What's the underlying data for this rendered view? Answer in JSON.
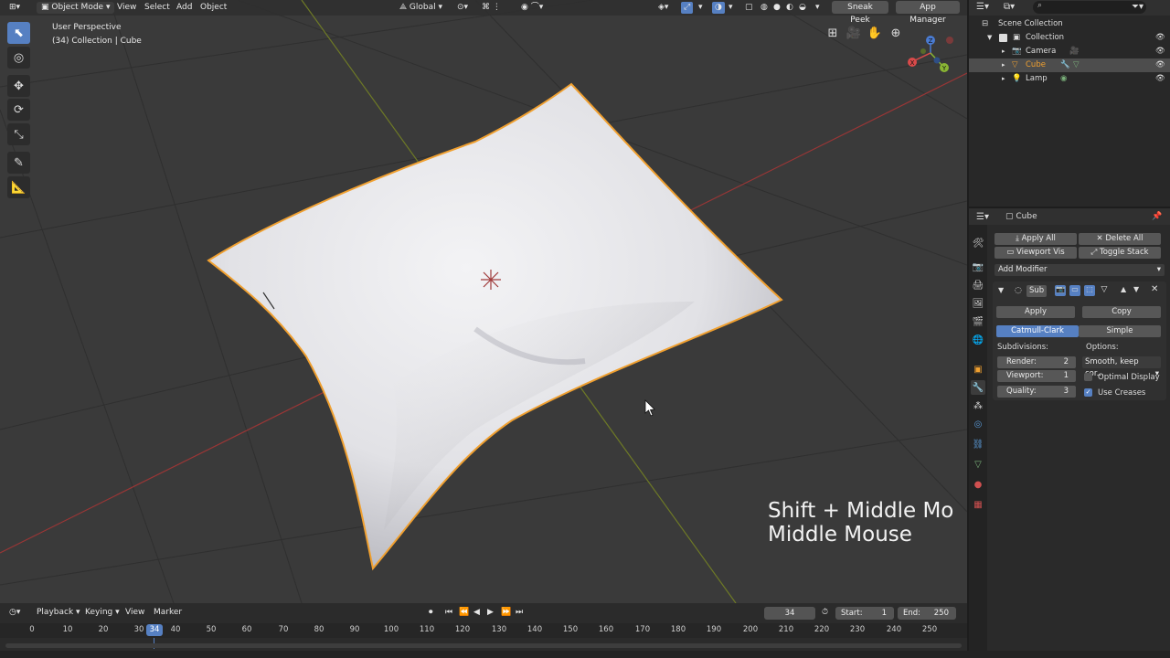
{
  "header": {
    "mode": "Object Mode",
    "menu": [
      "View",
      "Select",
      "Add",
      "Object"
    ],
    "transform_orientation": "Global",
    "sneak_peek": "Sneak Peek",
    "app_manager": "App Manager"
  },
  "viewport": {
    "perspective": "User Perspective",
    "collection_info": "(34) Collection | Cube",
    "overlay_line1": "Shift + Middle Mo",
    "overlay_line2": "Middle Mouse",
    "axis_x": "X",
    "axis_y": "Y",
    "axis_z": "Z"
  },
  "outliner": {
    "rows": [
      {
        "label": "Scene Collection"
      },
      {
        "label": "Collection"
      },
      {
        "label": "Camera"
      },
      {
        "label": "Cube"
      },
      {
        "label": "Lamp"
      }
    ]
  },
  "properties": {
    "object_name": "Cube",
    "apply_all": "Apply All",
    "delete_all": "Delete All",
    "viewport_vis": "Viewport Vis",
    "toggle_stack": "Toggle Stack",
    "add_modifier": "Add Modifier",
    "modifier_name": "Sub",
    "apply": "Apply",
    "copy": "Copy",
    "catmull_clark": "Catmull-Clark",
    "simple": "Simple",
    "subdivisions_label": "Subdivisions:",
    "options_label": "Options:",
    "render_label": "Render:",
    "render_value": "2",
    "viewport_label": "Viewport:",
    "viewport_value": "1",
    "quality_label": "Quality:",
    "quality_value": "3",
    "uv_option": "Smooth, keep cor...",
    "optimal_display": "Optimal Display",
    "use_creases": "Use Creases"
  },
  "timeline": {
    "playback": "Playback",
    "keying": "Keying",
    "view": "View",
    "marker": "Marker",
    "current_frame": "34",
    "start_label": "Start:",
    "start_value": "1",
    "end_label": "End:",
    "end_value": "250",
    "ticks": [
      "0",
      "10",
      "20",
      "30",
      "34",
      "40",
      "50",
      "60",
      "70",
      "80",
      "90",
      "100",
      "110",
      "120",
      "130",
      "140",
      "150",
      "160",
      "170",
      "180",
      "190",
      "200",
      "210",
      "220",
      "230",
      "240",
      "250"
    ]
  },
  "colors": {
    "accent": "#5680c2",
    "selection_outline": "#f0a030",
    "x_axis": "#9a3636",
    "y_axis": "#6e7a26"
  }
}
